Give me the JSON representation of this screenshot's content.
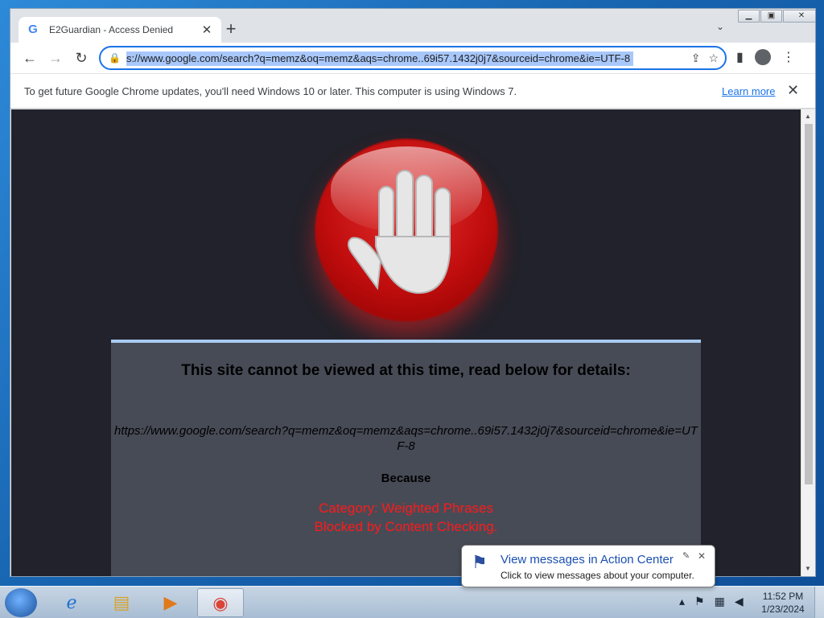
{
  "browser": {
    "tab_title": "E2Guardian - Access Denied",
    "tab_favicon": "G",
    "new_tab": "+",
    "address": "s://www.google.com/search?q=memz&oq=memz&aqs=chrome..69i57.1432j0j7&sourceid=chrome&ie=UTF-8",
    "infobar_message": "To get future Google Chrome updates, you'll need Windows 10 or later. This computer is using Windows 7.",
    "infobar_link": "Learn more"
  },
  "page": {
    "heading": "This site cannot be viewed at this time, read below for details:",
    "blocked_url": "https://www.google.com/search?q=memz&oq=memz&aqs=chrome..69i57.1432j0j7&sourceid=chrome&ie=UTF-8",
    "because": "Because",
    "reason_line1": "Category: Weighted Phrases",
    "reason_line2": "Blocked by Content Checking."
  },
  "notification": {
    "title": "View messages in Action Center",
    "body": "Click to view messages about your computer."
  },
  "taskbar": {
    "time": "11:52 PM",
    "date": "1/23/2024"
  },
  "colors": {
    "accent": "#1a73e8",
    "reason": "#ff1a1a",
    "page_bg": "#21222b",
    "panel_bg": "#474b56"
  }
}
